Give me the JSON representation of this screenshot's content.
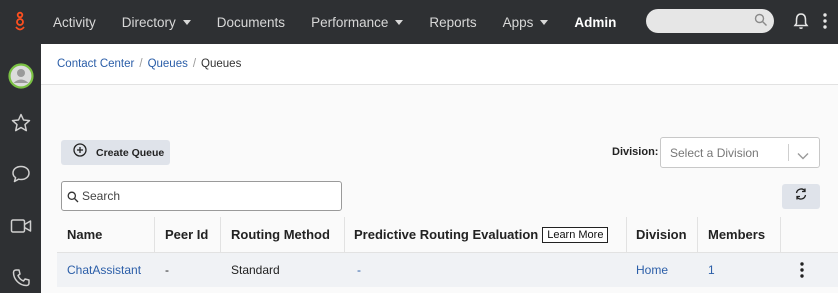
{
  "topnav": {
    "items": [
      {
        "label": "Activity",
        "dropdown": false
      },
      {
        "label": "Directory",
        "dropdown": true
      },
      {
        "label": "Documents",
        "dropdown": false
      },
      {
        "label": "Performance",
        "dropdown": true
      },
      {
        "label": "Reports",
        "dropdown": false
      },
      {
        "label": "Apps",
        "dropdown": true
      },
      {
        "label": "Admin",
        "dropdown": false
      }
    ],
    "search_placeholder": ""
  },
  "sidebar": {
    "icons": [
      "avatar",
      "star-icon",
      "chat-icon",
      "video-icon",
      "phone-icon"
    ]
  },
  "breadcrumb": {
    "items": [
      "Contact Center",
      "Queues",
      "Queues"
    ]
  },
  "toolbar": {
    "create_label": "Create Queue",
    "division_label": "Division:",
    "division_placeholder": "Select a Division",
    "search_placeholder": "Search"
  },
  "table": {
    "columns": [
      "Name",
      "Peer Id",
      "Routing Method",
      "Predictive Routing Evaluation",
      "Division",
      "Members"
    ],
    "learn_more": "Learn More",
    "rows": [
      {
        "name": "ChatAssistant",
        "peer_id": "-",
        "routing_method": "Standard",
        "predictive": "-",
        "division": "Home",
        "members": "1"
      }
    ]
  },
  "colors": {
    "topbar": "#2e3033",
    "accent_logo": "#ff4f1f",
    "link": "#2b5ea8",
    "button_bg": "#dfe3ea",
    "avatar_ring": "#7ac143"
  }
}
